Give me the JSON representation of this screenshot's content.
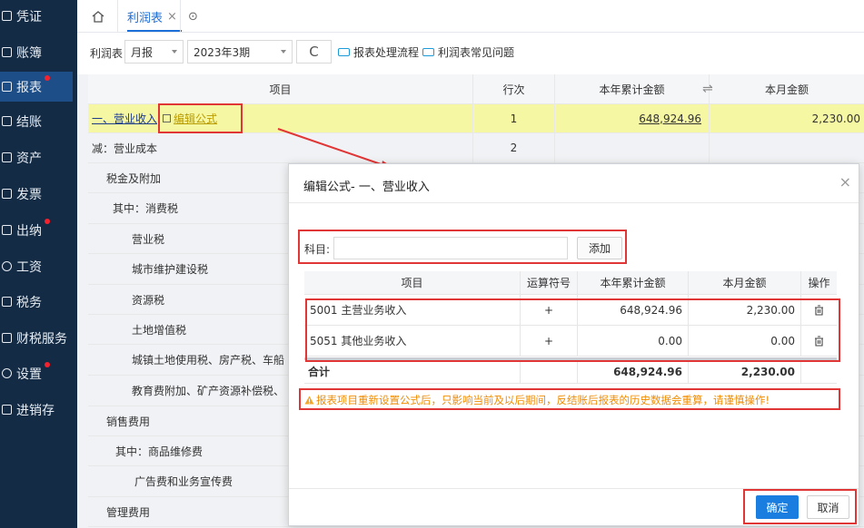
{
  "sidebar": {
    "items": [
      {
        "label": "凭证",
        "badge": false
      },
      {
        "label": "账簿",
        "badge": false
      },
      {
        "label": "报表",
        "badge": true
      },
      {
        "label": "结账",
        "badge": false
      },
      {
        "label": "资产",
        "badge": false
      },
      {
        "label": "发票",
        "badge": false
      },
      {
        "label": "出纳",
        "badge": true
      },
      {
        "label": "工资",
        "badge": false
      },
      {
        "label": "税务",
        "badge": false
      },
      {
        "label": "财税服务",
        "badge": false
      },
      {
        "label": "设置",
        "badge": true
      },
      {
        "label": "进销存",
        "badge": false
      }
    ]
  },
  "tabs": {
    "home_icon": "home-icon",
    "active_tab": "利润表",
    "close_glyph": "×",
    "more_glyph": "⊙"
  },
  "toolbar": {
    "report_label": "利润表",
    "period_type": "月报",
    "period": "2023年3期",
    "refresh_glyph": "C",
    "process_link": "报表处理流程",
    "faq_link": "利润表常见问题"
  },
  "main_table": {
    "headers": {
      "item": "项目",
      "line": "行次",
      "ytd": "本年累计金额",
      "month": "本月金额",
      "swap_glyph": "⇌"
    },
    "rows": [
      {
        "item": "一、营业收入",
        "line": "1",
        "ytd": "648,924.96",
        "month": "2,230.00"
      },
      {
        "item": "减：营业成本",
        "line": "2",
        "ytd": "",
        "month": ""
      },
      {
        "item": "税金及附加",
        "line": "",
        "ytd": "",
        "month": ""
      },
      {
        "item": "其中：消费税",
        "line": "",
        "ytd": "",
        "month": ""
      },
      {
        "item": "营业税",
        "line": "",
        "ytd": "",
        "month": ""
      },
      {
        "item": "城市维护建设税",
        "line": "",
        "ytd": "",
        "month": ""
      },
      {
        "item": "资源税",
        "line": "",
        "ytd": "",
        "month": ""
      },
      {
        "item": "土地增值税",
        "line": "",
        "ytd": "",
        "month": ""
      },
      {
        "item": "城镇土地使用税、房产税、车船",
        "line": "",
        "ytd": "",
        "month": ""
      },
      {
        "item": "教育费附加、矿产资源补偿税、",
        "line": "",
        "ytd": "",
        "month": ""
      },
      {
        "item": "销售费用",
        "line": "",
        "ytd": "",
        "month": ""
      },
      {
        "item": "其中：商品维修费",
        "line": "",
        "ytd": "",
        "month": ""
      },
      {
        "item": "广告费和业务宣传费",
        "line": "",
        "ytd": "",
        "month": ""
      },
      {
        "item": "管理费用",
        "line": "",
        "ytd": "",
        "month": ""
      }
    ],
    "edit_formula_link": "编辑公式",
    "highlight_color": "#f6f7a3"
  },
  "modal": {
    "title": "编辑公式- 一、营业收入",
    "close_glyph": "×",
    "subject_label": "科目:",
    "subject_value": "",
    "add_button": "添加",
    "headers": {
      "item": "项目",
      "op": "运算符号",
      "ytd": "本年累计金额",
      "month": "本月金额",
      "action": "操作"
    },
    "rows": [
      {
        "item": "5001 主营业务收入",
        "op": "+",
        "ytd": "648,924.96",
        "month": "2,230.00"
      },
      {
        "item": "5051 其他业务收入",
        "op": "+",
        "ytd": "0.00",
        "month": "0.00"
      }
    ],
    "total": {
      "label": "合计",
      "ytd": "648,924.96",
      "month": "2,230.00"
    },
    "warning": "报表项目重新设置公式后，只影响当前及以后期间，反结账后报表的历史数据会重算，请谨慎操作!",
    "confirm_button": "确定",
    "cancel_button": "取消",
    "accent_color": "#1a7ee0",
    "warning_color": "#f5a623"
  }
}
